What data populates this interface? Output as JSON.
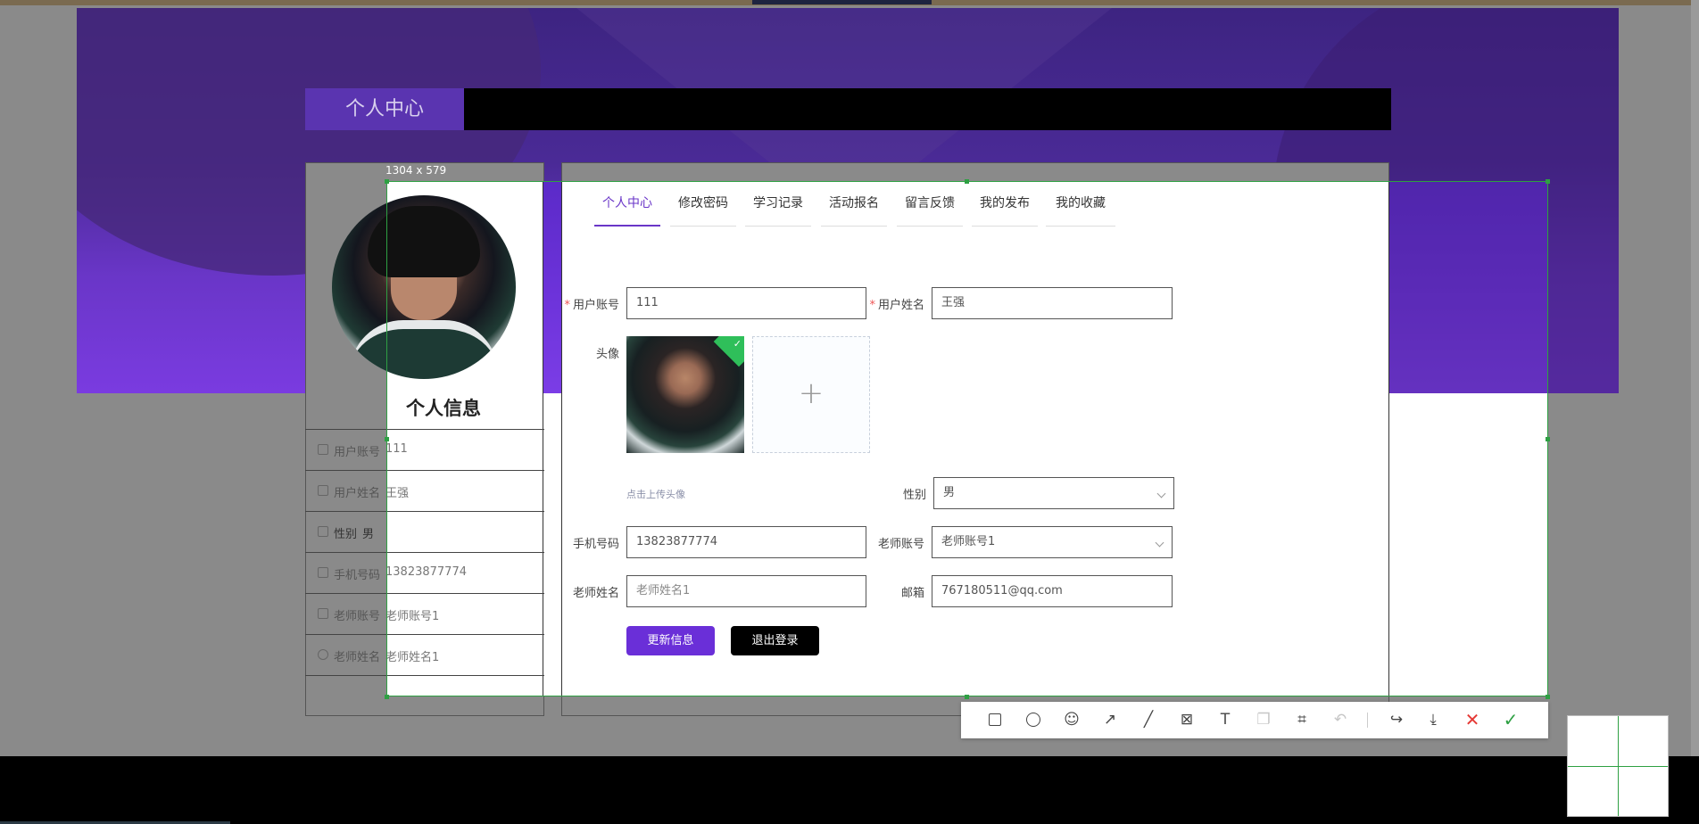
{
  "screenshot": {
    "dimension_label": "1304 x 579"
  },
  "header": {
    "title": "个人中心"
  },
  "profile_card": {
    "heading": "个人信息",
    "rows": [
      {
        "icon": "user-icon",
        "label": "用户账号",
        "value": "111"
      },
      {
        "icon": "id-card-icon",
        "label": "用户姓名",
        "value": "王强"
      },
      {
        "icon": "message-icon",
        "label": "性别",
        "value": "男"
      },
      {
        "icon": "edit-icon",
        "label": "手机号码",
        "value": "13823877774"
      },
      {
        "icon": "user-icon",
        "label": "老师账号",
        "value": "老师账号1"
      },
      {
        "icon": "clock-icon",
        "label": "老师姓名",
        "value": "老师姓名1"
      }
    ]
  },
  "tabs": [
    {
      "label": "个人中心",
      "active": true
    },
    {
      "label": "修改密码",
      "active": false
    },
    {
      "label": "学习记录",
      "active": false
    },
    {
      "label": "活动报名",
      "active": false
    },
    {
      "label": "留言反馈",
      "active": false
    },
    {
      "label": "我的发布",
      "active": false
    },
    {
      "label": "我的收藏",
      "active": false
    }
  ],
  "form": {
    "username": {
      "label": "用户账号",
      "value": "111",
      "required": true
    },
    "name": {
      "label": "用户姓名",
      "value": "王强",
      "required": true
    },
    "avatar": {
      "label": "头像",
      "upload_hint": "点击上传头像",
      "upload_plus": "+"
    },
    "gender": {
      "label": "性别",
      "value": "男"
    },
    "phone": {
      "label": "手机号码",
      "value": "13823877774"
    },
    "teacher_account": {
      "label": "老师账号",
      "value": "老师账号1"
    },
    "teacher_name": {
      "label": "老师姓名",
      "placeholder": "老师姓名1"
    },
    "email": {
      "label": "邮箱",
      "value": "767180511@qq.com"
    },
    "required_mark": "*",
    "submit_label": "更新信息",
    "logout_label": "退出登录"
  },
  "toolbar": {
    "tools": [
      "rectangle-icon",
      "ellipse-icon",
      "emoji-icon",
      "arrow-icon",
      "pen-icon",
      "mosaic-icon",
      "text-icon",
      "copy-icon",
      "ocr-icon",
      "undo-icon",
      "share-icon",
      "save-icon",
      "close-icon",
      "confirm-icon"
    ]
  },
  "colors": {
    "accent": "#6a36c8",
    "selection": "#2ea043",
    "danger": "#e53935"
  }
}
